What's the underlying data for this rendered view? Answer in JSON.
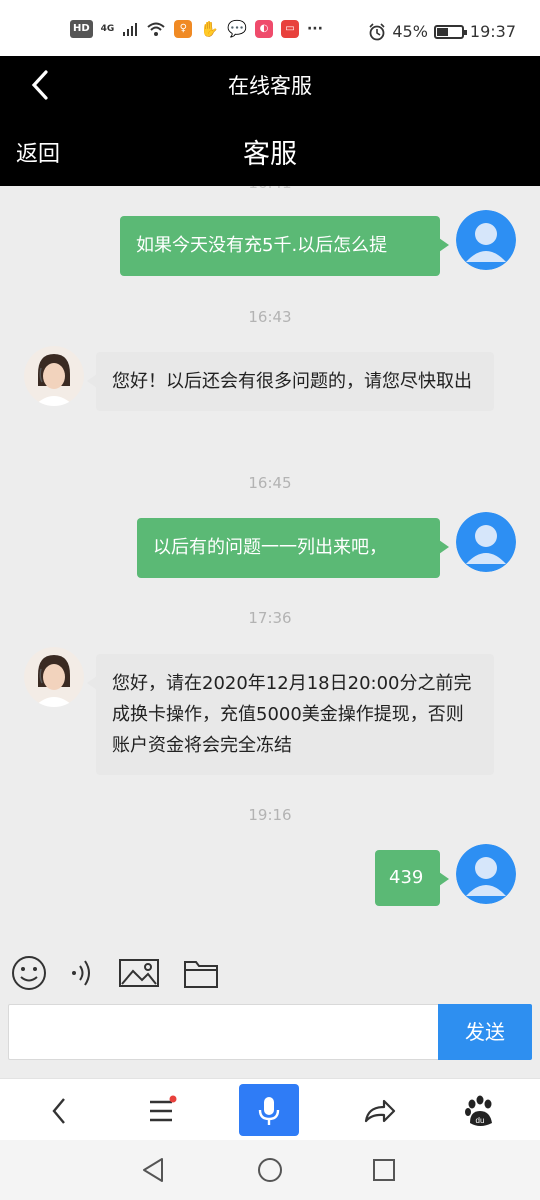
{
  "status_bar": {
    "network": "4G",
    "hd": "HD",
    "battery_percent": "45%",
    "battery_level": 0.45,
    "time": "19:37",
    "more": "···"
  },
  "header": {
    "title": "在线客服"
  },
  "subheader": {
    "back_label": "返回",
    "title": "客服"
  },
  "chat": {
    "messages": [
      {
        "side": "me",
        "text": "如果今天没有充5千.以后怎么提"
      },
      {
        "time": "16:43"
      },
      {
        "side": "them",
        "text": "您好！以后还会有很多问题的，请您尽快取出"
      },
      {
        "time": "16:45"
      },
      {
        "side": "me",
        "text": "以后有的问题一一列出来吧，"
      },
      {
        "time": "17:36"
      },
      {
        "side": "them",
        "text": "您好，请在2020年12月18日20:00分之前完成换卡操作，充值5000美金操作提现，否则账户资金将会完全冻结"
      },
      {
        "time": "19:16"
      },
      {
        "side": "me",
        "text": "439"
      }
    ]
  },
  "composer": {
    "input_value": "",
    "send_label": "发送"
  },
  "colors": {
    "me_bubble": "#5bb975",
    "them_bubble": "#e8e8e8",
    "send_button": "#2e8ff0",
    "header_bg": "#000000",
    "mic_button": "#2f7cf6"
  }
}
